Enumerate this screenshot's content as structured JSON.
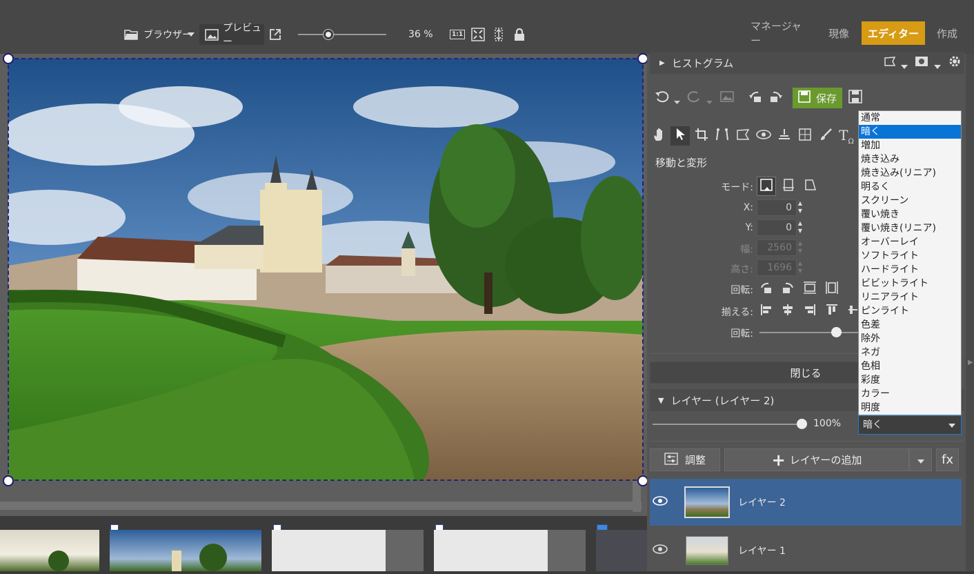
{
  "toolbar": {
    "browser_label": "ブラウザー",
    "preview_label": "プレビュー",
    "zoom_value": "36 %",
    "zoom_slider_fraction": 0.34,
    "one_to_one": "1:1"
  },
  "modes": {
    "manager": "マネージャー",
    "develop": "現像",
    "editor": "エディター",
    "create": "作成",
    "active_color": "#d89b14"
  },
  "panel": {
    "histogram_title": "ヒストグラム",
    "save_label": "保存",
    "section_title": "移動と変形",
    "mode_label": "モード:",
    "x_label": "X:",
    "x_value": "0",
    "y_label": "Y:",
    "y_value": "0",
    "width_label": "幅:",
    "width_value": "2560",
    "height_label": "高さ:",
    "height_value": "1696",
    "rotate_label": "回転:",
    "align_label": "揃える:",
    "rotate_slider_label": "回転:",
    "close_button": "閉じる",
    "layers_title": "レイヤー (レイヤー 2)",
    "opacity_value": "100%",
    "opacity_fraction": 1.0,
    "adjust_button": "調整",
    "add_layer_button": "レイヤーの追加",
    "fx_button": "fx"
  },
  "blend": {
    "selected": "暗く",
    "options": [
      "通常",
      "暗く",
      "増加",
      "焼き込み",
      "焼き込み(リニア)",
      "明るく",
      "スクリーン",
      "覆い焼き",
      "覆い焼き(リニア)",
      "オーバーレイ",
      "ソフトライト",
      "ハードライト",
      "ビビットライト",
      "リニアライト",
      "ピンライト",
      "色差",
      "除外",
      "ネガ",
      "色相",
      "彩度",
      "カラー",
      "明度"
    ],
    "selected_index": 1
  },
  "layers": [
    {
      "name": "レイヤー 2",
      "selected": true
    },
    {
      "name": "レイヤー 1",
      "selected": false
    }
  ],
  "colors": {
    "accent_green": "#6a9a2e",
    "selection_blue": "#0a74d6",
    "layer_selected": "#3d6497"
  }
}
